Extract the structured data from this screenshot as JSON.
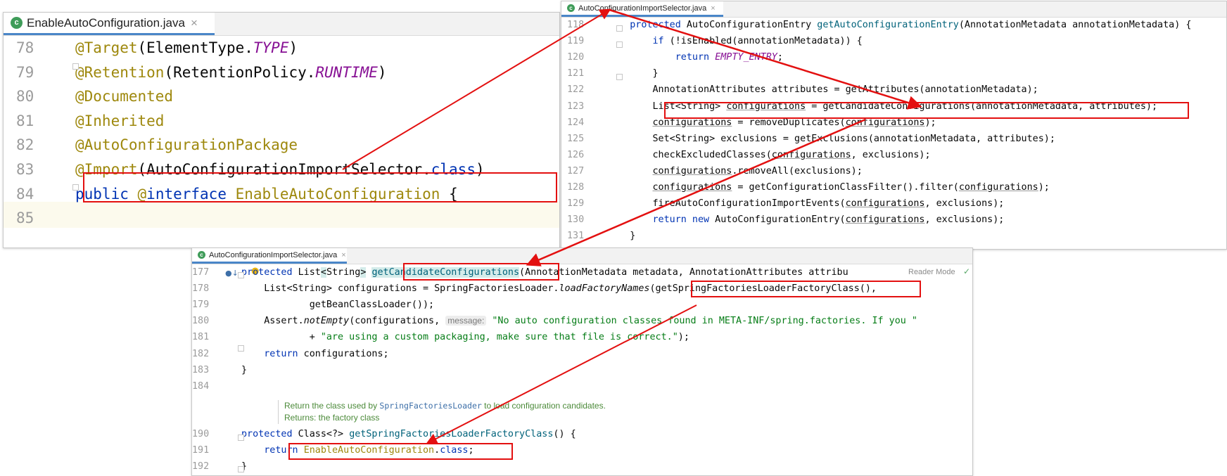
{
  "editors": {
    "left": {
      "tab": {
        "icon": "c",
        "filename": "EnableAutoConfiguration.java",
        "close": "×"
      },
      "lines": [
        {
          "num": "78",
          "code": [
            [
              "an",
              "@Target"
            ],
            [
              "",
              "(ElementType."
            ],
            [
              "const",
              "TYPE"
            ],
            [
              "",
              ")"
            ]
          ]
        },
        {
          "num": "79",
          "code": [
            [
              "an",
              "@Retention"
            ],
            [
              "",
              "(RetentionPolicy."
            ],
            [
              "const",
              "RUNTIME"
            ],
            [
              "",
              ")"
            ]
          ]
        },
        {
          "num": "80",
          "code": [
            [
              "an",
              "@Documented"
            ]
          ]
        },
        {
          "num": "81",
          "code": [
            [
              "an",
              "@Inherited"
            ]
          ]
        },
        {
          "num": "82",
          "code": [
            [
              "an",
              "@AutoConfigurationPackage"
            ]
          ]
        },
        {
          "num": "83",
          "code": [
            [
              "an",
              "@Import"
            ],
            [
              "",
              "(AutoConfigurationImportSelector."
            ],
            [
              "kw",
              "class"
            ],
            [
              "",
              ")"
            ]
          ]
        },
        {
          "num": "84",
          "code": [
            [
              "kw",
              "public"
            ],
            [
              "",
              " "
            ],
            [
              "an",
              "@"
            ],
            [
              "kw",
              "interface"
            ],
            [
              "",
              " "
            ],
            [
              "an",
              "EnableAutoConfiguration"
            ],
            [
              "",
              " {"
            ]
          ]
        },
        {
          "num": "85",
          "code": []
        }
      ]
    },
    "right": {
      "tab": {
        "icon": "c",
        "filename": "AutoConfigurationImportSelector.java",
        "close": "×"
      },
      "lines": [
        {
          "num": "118",
          "code": [
            [
              "",
              "    "
            ],
            [
              "kw",
              "protected"
            ],
            [
              "",
              " AutoConfigurationEntry "
            ],
            [
              "meth",
              "getAutoConfigurationEntry"
            ],
            [
              "",
              "(AnnotationMetadata annotationMetadata) {"
            ]
          ]
        },
        {
          "num": "119",
          "code": [
            [
              "",
              "        "
            ],
            [
              "kw",
              "if"
            ],
            [
              "",
              " (!isEnabled(annotationMetadata)) {"
            ]
          ]
        },
        {
          "num": "120",
          "code": [
            [
              "",
              "            "
            ],
            [
              "kw",
              "return"
            ],
            [
              "",
              " "
            ],
            [
              "const",
              "EMPTY_ENTRY"
            ],
            [
              "",
              ";"
            ]
          ]
        },
        {
          "num": "121",
          "code": [
            [
              "",
              "        }"
            ]
          ]
        },
        {
          "num": "122",
          "code": [
            [
              "",
              "        AnnotationAttributes attributes = getAttributes(annotationMetadata);"
            ]
          ]
        },
        {
          "num": "123",
          "code": [
            [
              "",
              "        List<String> "
            ],
            [
              "ul",
              "configurations"
            ],
            [
              "",
              " = getCandidateConfigurations(annotationMetadata, attributes);"
            ]
          ]
        },
        {
          "num": "124",
          "code": [
            [
              "",
              "        "
            ],
            [
              "ul",
              "configurations"
            ],
            [
              "",
              " = removeDuplicates("
            ],
            [
              "ul",
              "configurations"
            ],
            [
              "",
              ");"
            ]
          ]
        },
        {
          "num": "125",
          "code": [
            [
              "",
              "        Set<String> exclusions = getExclusions(annotationMetadata, attributes);"
            ]
          ]
        },
        {
          "num": "126",
          "code": [
            [
              "",
              "        checkExcludedClasses("
            ],
            [
              "ul",
              "configurations"
            ],
            [
              "",
              ", exclusions);"
            ]
          ]
        },
        {
          "num": "127",
          "code": [
            [
              "",
              "        "
            ],
            [
              "ul",
              "configurations"
            ],
            [
              "",
              ".removeAll(exclusions);"
            ]
          ]
        },
        {
          "num": "128",
          "code": [
            [
              "",
              "        "
            ],
            [
              "ul",
              "configurations"
            ],
            [
              "",
              " = getConfigurationClassFilter().filter("
            ],
            [
              "ul",
              "configurations"
            ],
            [
              "",
              ");"
            ]
          ]
        },
        {
          "num": "129",
          "code": [
            [
              "",
              "        fireAutoConfigurationImportEvents("
            ],
            [
              "ul",
              "configurations"
            ],
            [
              "",
              ", exclusions);"
            ]
          ]
        },
        {
          "num": "130",
          "code": [
            [
              "",
              "        "
            ],
            [
              "kw",
              "return new"
            ],
            [
              "",
              " AutoConfigurationEntry("
            ],
            [
              "ul",
              "configurations"
            ],
            [
              "",
              ", exclusions);"
            ]
          ]
        },
        {
          "num": "131",
          "code": [
            [
              "",
              "    }"
            ]
          ]
        }
      ]
    },
    "bottom": {
      "tab": {
        "icon": "c",
        "filename": "AutoConfigurationImportSelector.java",
        "close": "×"
      },
      "reader_mode": "Reader Mode",
      "lines": [
        {
          "num": "177",
          "code": [
            [
              "kw",
              "protected"
            ],
            [
              "",
              " List"
            ],
            [
              "hl",
              "<"
            ],
            [
              "",
              "String"
            ],
            [
              "hl",
              ">"
            ],
            [
              "",
              " "
            ],
            [
              "meth hl",
              "getCandidateConfigurations"
            ],
            [
              "",
              "(AnnotationMetadata metadata, AnnotationAttributes attribu"
            ]
          ]
        },
        {
          "num": "178",
          "code": [
            [
              "",
              "    List<String> configurations = SpringFactoriesLoader."
            ],
            [
              "it",
              "loadFactoryNames"
            ],
            [
              "",
              "(getSpringFactoriesLoaderFactoryClass(),"
            ]
          ]
        },
        {
          "num": "179",
          "code": [
            [
              "",
              "            getBeanClassLoader());"
            ]
          ]
        },
        {
          "num": "180",
          "code": [
            [
              "",
              "    Assert."
            ],
            [
              "it",
              "notEmpty"
            ],
            [
              "",
              "(configurations, "
            ],
            [
              "hint",
              "message:"
            ],
            [
              "",
              " "
            ],
            [
              "str",
              "\"No auto configuration classes found in META-INF/spring.factories. If you \""
            ]
          ]
        },
        {
          "num": "181",
          "code": [
            [
              "",
              "            + "
            ],
            [
              "str",
              "\"are using a custom packaging, make sure that file is correct.\""
            ],
            [
              "",
              ");"
            ]
          ]
        },
        {
          "num": "182",
          "code": [
            [
              "",
              "    "
            ],
            [
              "kw",
              "return"
            ],
            [
              "",
              " configurations;"
            ]
          ]
        },
        {
          "num": "183",
          "code": [
            [
              "",
              "}"
            ]
          ]
        },
        {
          "num": "184",
          "code": []
        }
      ],
      "doc": {
        "line1_pre": "Return the class used by ",
        "line1_ref": "SpringFactoriesLoader",
        "line1_post": " to load configuration candidates.",
        "line2": "Returns: the factory class"
      },
      "lines2": [
        {
          "num": "190",
          "code": [
            [
              "kw",
              "protected"
            ],
            [
              "",
              " Class<?> "
            ],
            [
              "meth",
              "getSpringFactoriesLoaderFactoryClass"
            ],
            [
              "",
              "() {"
            ]
          ]
        },
        {
          "num": "191",
          "code": [
            [
              "",
              "    "
            ],
            [
              "kw",
              "return"
            ],
            [
              "",
              " "
            ],
            [
              "an",
              "EnableAutoConfiguration"
            ],
            [
              "",
              "."
            ],
            [
              "kw",
              "class"
            ],
            [
              "",
              ";"
            ]
          ]
        },
        {
          "num": "192",
          "code": [
            [
              "",
              "}"
            ]
          ]
        }
      ]
    }
  },
  "colors": {
    "keyword": "#0033b3",
    "annotation": "#9e880d",
    "constant": "#871094",
    "method": "#00627a",
    "string": "#067d17",
    "highlight_box": "#e31010",
    "arrow": "#e31010"
  }
}
